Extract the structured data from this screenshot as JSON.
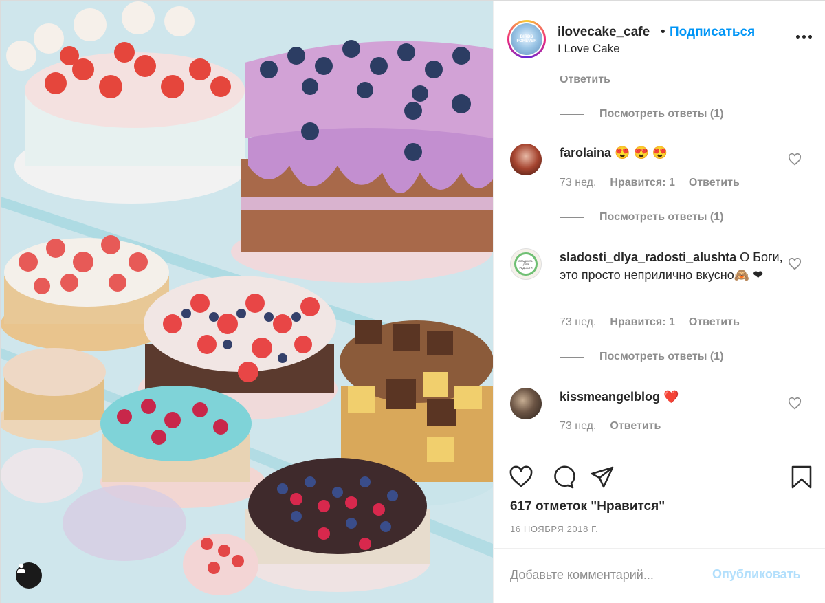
{
  "photo": {
    "alt_icon": "user-tag-icon"
  },
  "header": {
    "username": "ilovecake_cafe",
    "dot": "•",
    "follow_label": "Подписаться",
    "display_name": "I Love Cake",
    "avatar_text": "BIRDS FOREVER",
    "more_icon": "more-options-icon"
  },
  "comments": {
    "partial_reply_label": "Ответить",
    "view_replies_top": "Посмотреть ответы (1)",
    "items": [
      {
        "username": "farolaina",
        "text": "😍 😍 😍",
        "time": "73 нед.",
        "likes": "Нравится: 1",
        "reply": "Ответить",
        "view_replies": "Посмотреть ответы (1)"
      },
      {
        "username": "sladosti_dlya_radosti_alushta",
        "text": "О Боги, это просто неприлично вкусно🙈 ❤",
        "time": "73 нед.",
        "likes": "Нравится: 1",
        "reply": "Ответить",
        "view_replies": "Посмотреть ответы (1)",
        "avatar_text": "СЛАДОСТИ ДЛЯ РАДОСТИ"
      },
      {
        "username": "kissmeangelblog",
        "text": "❤️",
        "time": "73 нед.",
        "reply": "Ответить"
      }
    ]
  },
  "actions": {
    "likes_count": "617 отметок \"Нравится\"",
    "date": "16 НОЯБРЯ 2018 Г."
  },
  "add_comment": {
    "placeholder": "Добавьте комментарий...",
    "publish_label": "Опубликовать"
  },
  "colors": {
    "link_blue": "#0095f6",
    "publish_disabled": "#b2dffc",
    "muted": "#8e8e8e",
    "text": "#262626"
  }
}
